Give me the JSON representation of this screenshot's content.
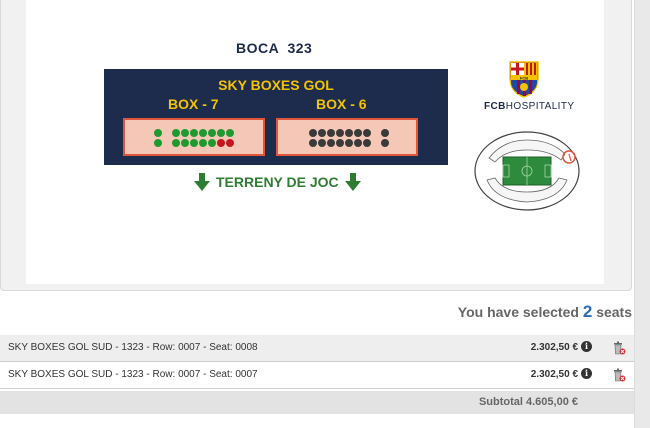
{
  "map": {
    "boca_title": "BOCA  323",
    "section_title": "SKY BOXES GOL",
    "box_left": {
      "label": "BOX - 7",
      "rows": [
        [
          "green",
          null,
          "green",
          "green",
          "green",
          "green",
          "green",
          "green",
          "green"
        ],
        [
          "green",
          null,
          "green",
          "green",
          "green",
          "green",
          "green",
          "red",
          "red"
        ]
      ]
    },
    "box_right": {
      "label": "BOX - 6",
      "rows": [
        [
          "dark",
          "dark",
          "dark",
          "dark",
          "dark",
          "dark",
          "dark",
          null,
          "dark"
        ],
        [
          "dark",
          "dark",
          "dark",
          "dark",
          "dark",
          "dark",
          "dark",
          null,
          "dark"
        ]
      ]
    },
    "field_label": "TERRENY DE JOC"
  },
  "logo": {
    "crest_letters": "FCB",
    "brand_bold": "FCB",
    "brand_rest": "HOSPITALITY"
  },
  "colors": {
    "seat_green": "#1f9a2f",
    "seat_red": "#c4161c",
    "seat_dark": "#3a3a3a",
    "panel_navy": "#1d2c4d",
    "label_yellow": "#f5c300",
    "field_green": "#2e7d32"
  },
  "selection": {
    "prefix": "You have selected",
    "count": "2",
    "suffix": "seats"
  },
  "seats": [
    {
      "description": "SKY BOXES GOL SUD - 1323 - Row: 0007 - Seat: 0008",
      "price": "2.302,50 €"
    },
    {
      "description": "SKY BOXES GOL SUD - 1323 - Row: 0007 - Seat: 0007",
      "price": "2.302,50 €"
    }
  ],
  "icons": {
    "info": "info-icon",
    "trash": "trash-icon",
    "arrow": "arrow-down-icon"
  },
  "subtotal": "Subtotal 4.605,00 €"
}
